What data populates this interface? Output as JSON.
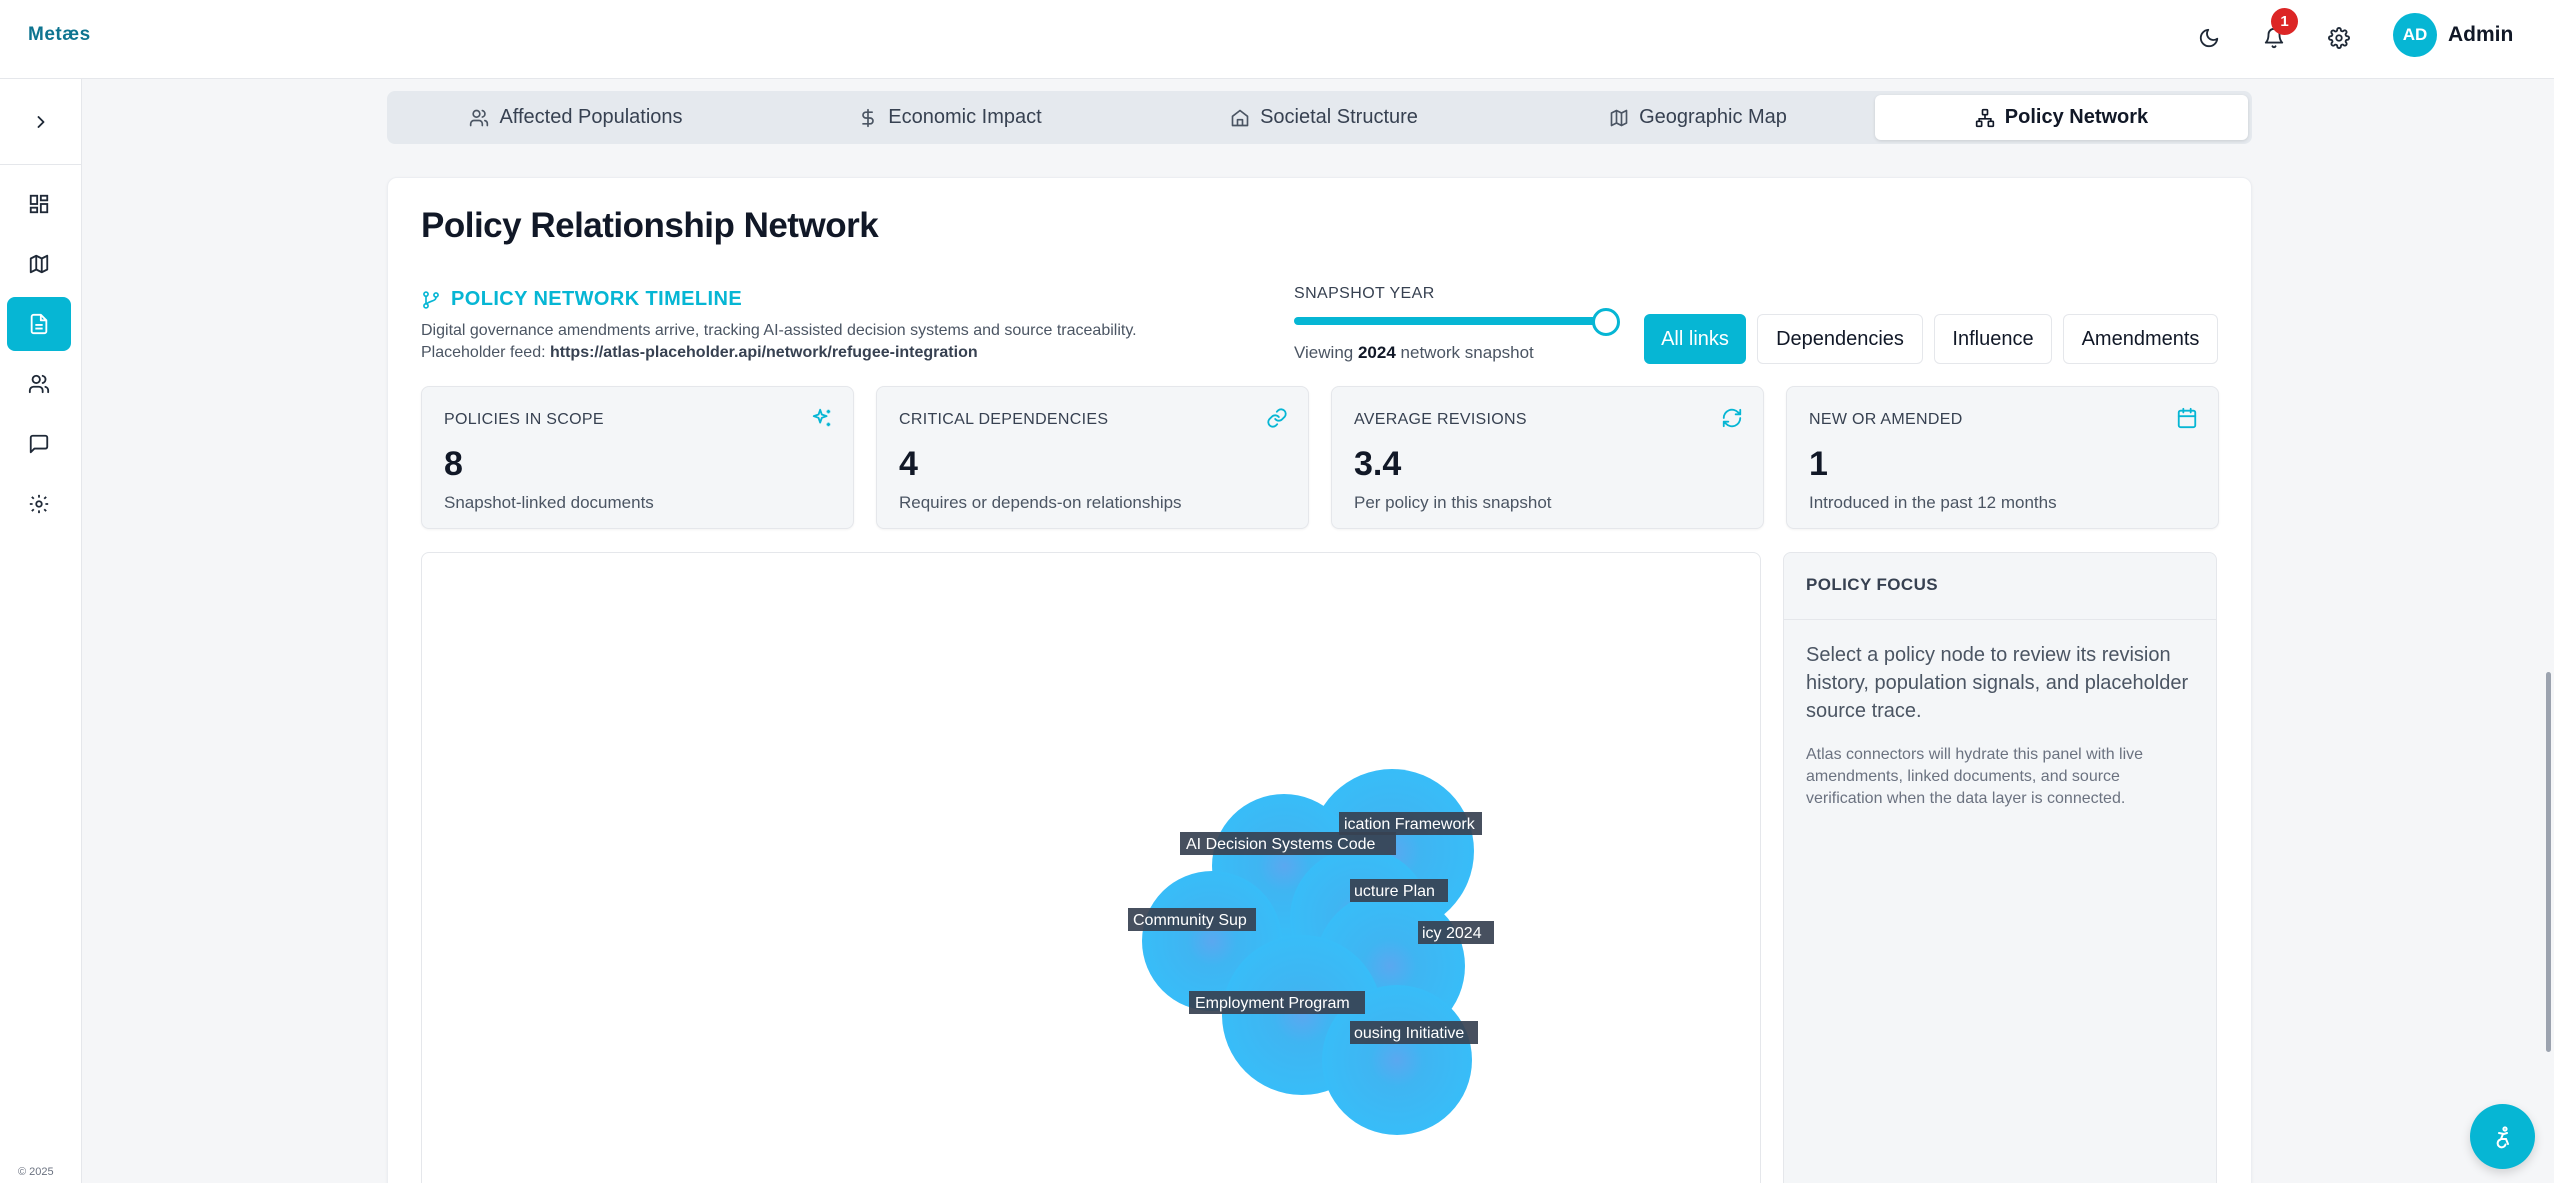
{
  "app": {
    "logo": "Metæs",
    "notifications_count": "1",
    "user_initials": "AD",
    "user_name": "Admin",
    "copyright": "© 2025",
    "accent_color": "#06b6d4"
  },
  "tabs": [
    {
      "label": "Affected Populations",
      "icon": "users-icon"
    },
    {
      "label": "Economic Impact",
      "icon": "dollar-icon"
    },
    {
      "label": "Societal Structure",
      "icon": "home-icon"
    },
    {
      "label": "Geographic Map",
      "icon": "map-icon"
    },
    {
      "label": "Policy Network",
      "icon": "network-icon",
      "active": true
    }
  ],
  "network": {
    "title": "Policy Relationship Network",
    "timeline_title": "POLICY NETWORK TIMELINE",
    "description": "Digital governance amendments arrive, tracking AI-assisted decision systems and source traceability.",
    "feed_label": "Placeholder feed:",
    "feed_url": "https://atlas-placeholder.api/network/refugee-integration",
    "snapshot_label": "SNAPSHOT YEAR",
    "viewing_prefix": "Viewing",
    "snapshot_year": "2024",
    "viewing_suffix": "network snapshot",
    "snapshot_position": 1.0,
    "filters": [
      "All links",
      "Dependencies",
      "Influence",
      "Amendments"
    ],
    "active_filter": "All links"
  },
  "stats": [
    {
      "label": "POLICIES IN SCOPE",
      "value": "8",
      "sub": "Snapshot-linked documents",
      "icon": "sparkles-icon"
    },
    {
      "label": "CRITICAL DEPENDENCIES",
      "value": "4",
      "sub": "Requires or depends-on relationships",
      "icon": "link-icon"
    },
    {
      "label": "AVERAGE REVISIONS",
      "value": "3.4",
      "sub": "Per policy in this snapshot",
      "icon": "refresh-icon"
    },
    {
      "label": "NEW OR AMENDED",
      "value": "1",
      "sub": "Introduced in the past 12 months",
      "icon": "calendar-icon"
    }
  ],
  "graph_nodes": [
    {
      "label": "ication Framework"
    },
    {
      "label": "AI Decision Systems Code"
    },
    {
      "label": "ucture Plan"
    },
    {
      "label": "Community Sup"
    },
    {
      "label": "icy 2024"
    },
    {
      "label": "Employment Program"
    },
    {
      "label": "ousing Initiative"
    }
  ],
  "focus": {
    "title": "POLICY FOCUS",
    "main": "Select a policy node to review its revision history, population signals, and placeholder source trace.",
    "note": "Atlas connectors will hydrate this panel with live amendments, linked documents, and source verification when the data layer is connected."
  }
}
